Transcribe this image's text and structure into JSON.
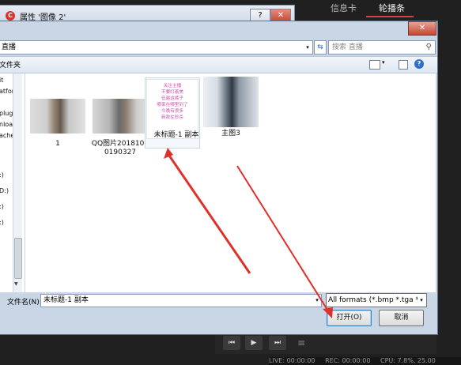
{
  "background_app": {
    "tabs": [
      "信息卡",
      "轮播条"
    ],
    "active_tab": "轮播条",
    "player_buttons": [
      "⏮",
      "▶",
      "⏭",
      "≡"
    ],
    "status": {
      "live": "LIVE: 00:00:00",
      "rec": "REC: 00:00:00",
      "cpu": "CPU: 7.8%, 25.00"
    }
  },
  "properties_window": {
    "title": "属性 '图像 2'",
    "help_glyph": "?",
    "close_glyph": "✕"
  },
  "dialog": {
    "close_glyph": "✕",
    "address": "直播",
    "search_placeholder": "搜索 直播",
    "toolbar_label": "文件夹",
    "nav_items": [
      "it",
      "atfor",
      "",
      "plugi",
      "nload",
      "ache",
      "",
      ":)",
      "D:)",
      ":)",
      ":)"
    ],
    "files": [
      {
        "name": "1"
      },
      {
        "name": "QQ图片20181020190327"
      },
      {
        "name": "未标题-1 副本",
        "preview_lines": [
          "关注主播",
          "不要盯着美",
          "伍越这裤子",
          "哪家在哪里到了",
          "今晚有很多",
          "新款在秒杀"
        ]
      },
      {
        "name": "主图3"
      }
    ],
    "filename_label": "文件名(N):",
    "filename_value": "未标题-1 副本",
    "filter_value": "All formats (*.bmp *.tga *.pn",
    "open_button": "打开(O)",
    "cancel_button": "取消"
  },
  "colors": {
    "arrow": "#e0302a",
    "accent": "#d94040"
  }
}
